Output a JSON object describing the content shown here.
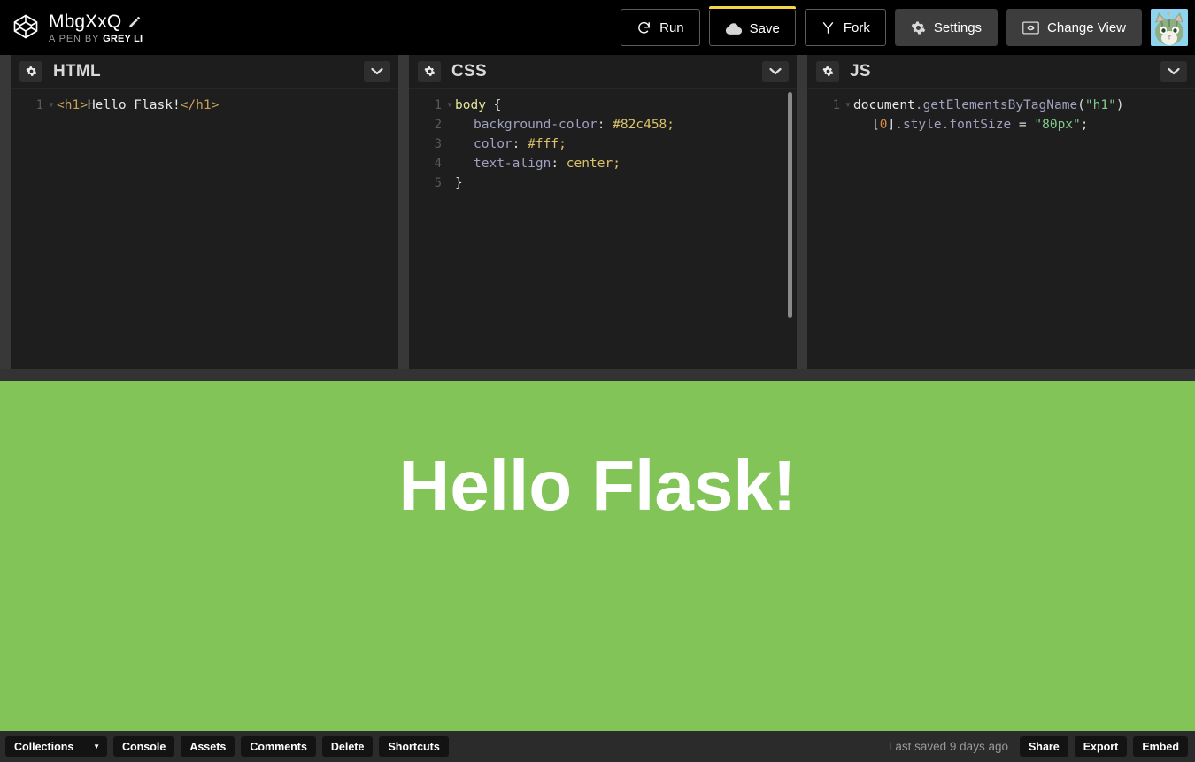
{
  "header": {
    "logo_icon": "codepen-logo-icon",
    "pen_title": "MbgXxQ",
    "edit_icon": "pencil-icon",
    "pen_by_prefix": "A PEN BY",
    "author": "Grey Li",
    "buttons": [
      {
        "label": "Run",
        "icon": "refresh-icon",
        "style": "outline"
      },
      {
        "label": "Save",
        "icon": "cloud-icon",
        "style": "outline-accent"
      },
      {
        "label": "Fork",
        "icon": "fork-icon",
        "style": "outline"
      },
      {
        "label": "Settings",
        "icon": "gear-icon",
        "style": "soft"
      },
      {
        "label": "Change View",
        "icon": "eye-box-icon",
        "style": "soft"
      }
    ],
    "avatar_alt": "cat-avatar",
    "accent_color": "#f5d547"
  },
  "editors": [
    {
      "title": "HTML",
      "gear_icon": "gear-icon",
      "chevron_icon": "chevron-down-icon",
      "has_scrollbar": false,
      "lines": [
        {
          "n": "1",
          "fold": true,
          "code": "<h1>Hello Flask!</h1>"
        }
      ]
    },
    {
      "title": "CSS",
      "gear_icon": "gear-icon",
      "chevron_icon": "chevron-down-icon",
      "has_scrollbar": true,
      "lines": [
        {
          "n": "1",
          "fold": true,
          "code": "body {"
        },
        {
          "n": "2",
          "fold": false,
          "code": "  background-color: #82c458;"
        },
        {
          "n": "3",
          "fold": false,
          "code": "  color: #fff;"
        },
        {
          "n": "4",
          "fold": false,
          "code": "  text-align: center;"
        },
        {
          "n": "5",
          "fold": false,
          "code": "}"
        }
      ]
    },
    {
      "title": "JS",
      "gear_icon": "gear-icon",
      "chevron_icon": "chevron-down-icon",
      "has_scrollbar": false,
      "lines": [
        {
          "n": "1",
          "fold": true,
          "code": "document.getElementsByTagName(\"h1\")[0].style.fontSize = \"80px\";"
        }
      ]
    }
  ],
  "preview": {
    "background_color": "#82c458",
    "heading_text": "Hello Flask!",
    "heading_color": "#ffffff",
    "heading_size": "80px"
  },
  "footer": {
    "left_buttons": [
      {
        "label": "Collections",
        "icon": "chevron-down-icon"
      },
      {
        "label": "Console"
      },
      {
        "label": "Assets"
      },
      {
        "label": "Comments"
      },
      {
        "label": "Delete"
      },
      {
        "label": "Shortcuts"
      }
    ],
    "saved_status": "Last saved 9 days ago",
    "right_buttons": [
      {
        "label": "Share"
      },
      {
        "label": "Export"
      },
      {
        "label": "Embed"
      }
    ]
  }
}
